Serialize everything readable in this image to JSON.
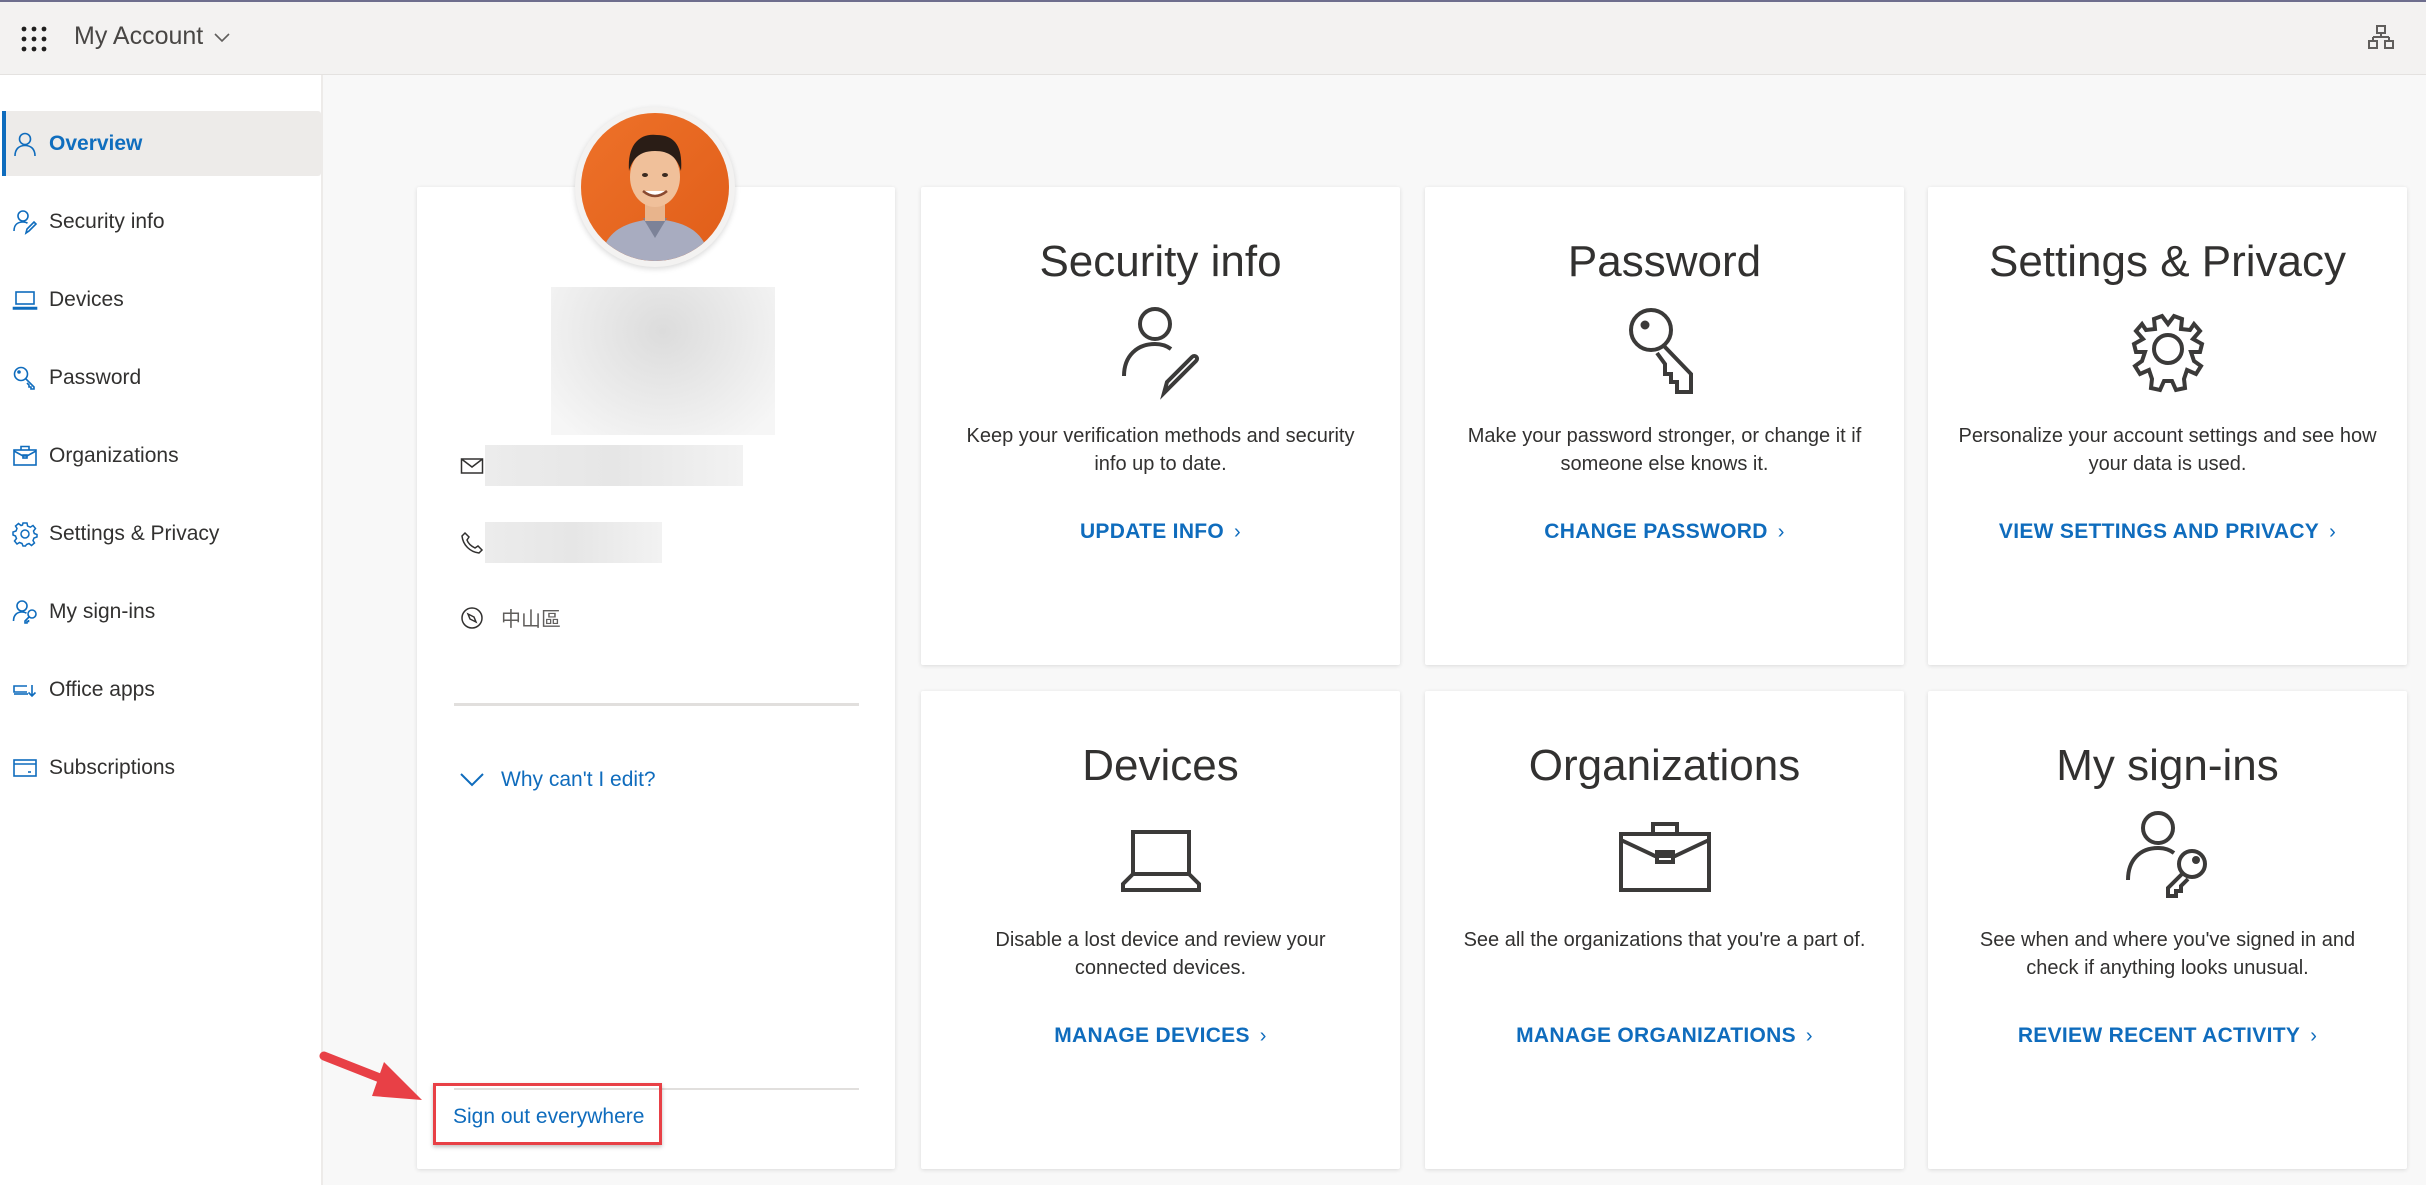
{
  "header": {
    "title": "My Account",
    "app_launcher_icon": "waffle-icon",
    "title_dropdown_icon": "chevron-down-icon",
    "org_icon": "org-chart-icon"
  },
  "sidebar": {
    "items": [
      {
        "label": "Overview",
        "icon": "person-icon",
        "active": true
      },
      {
        "label": "Security info",
        "icon": "person-edit-icon",
        "active": false
      },
      {
        "label": "Devices",
        "icon": "laptop-icon",
        "active": false
      },
      {
        "label": "Password",
        "icon": "key-icon",
        "active": false
      },
      {
        "label": "Organizations",
        "icon": "briefcase-icon",
        "active": false
      },
      {
        "label": "Settings & Privacy",
        "icon": "gear-icon",
        "active": false
      },
      {
        "label": "My sign-ins",
        "icon": "person-key-icon",
        "active": false
      },
      {
        "label": "Office apps",
        "icon": "office-download-icon",
        "active": false
      },
      {
        "label": "Subscriptions",
        "icon": "card-icon",
        "active": false
      }
    ]
  },
  "profile": {
    "location": "中山區",
    "why_cant_edit": "Why can't I edit?",
    "sign_out": "Sign out everywhere"
  },
  "tiles": [
    {
      "title": "Security info",
      "icon": "person-edit-icon",
      "description": "Keep your verification methods and security info up to date.",
      "link": "UPDATE INFO"
    },
    {
      "title": "Password",
      "icon": "key-icon",
      "description": "Make your password stronger, or change it if someone else knows it.",
      "link": "CHANGE PASSWORD"
    },
    {
      "title": "Settings & Privacy",
      "icon": "gear-icon",
      "description": "Personalize your account settings and see how your data is used.",
      "link": "VIEW SETTINGS AND PRIVACY"
    },
    {
      "title": "Devices",
      "icon": "laptop-icon",
      "description": "Disable a lost device and review your connected devices.",
      "link": "MANAGE DEVICES"
    },
    {
      "title": "Organizations",
      "icon": "briefcase-icon",
      "description": "See all the organizations that you're a part of.",
      "link": "MANAGE ORGANIZATIONS"
    },
    {
      "title": "My sign-ins",
      "icon": "person-key-icon",
      "description": "See when and where you've signed in and check if anything looks unusual.",
      "link": "REVIEW RECENT ACTIVITY"
    }
  ],
  "colors": {
    "accent": "#0f6cbd",
    "text": "#323130",
    "highlight_box": "#e84046"
  }
}
